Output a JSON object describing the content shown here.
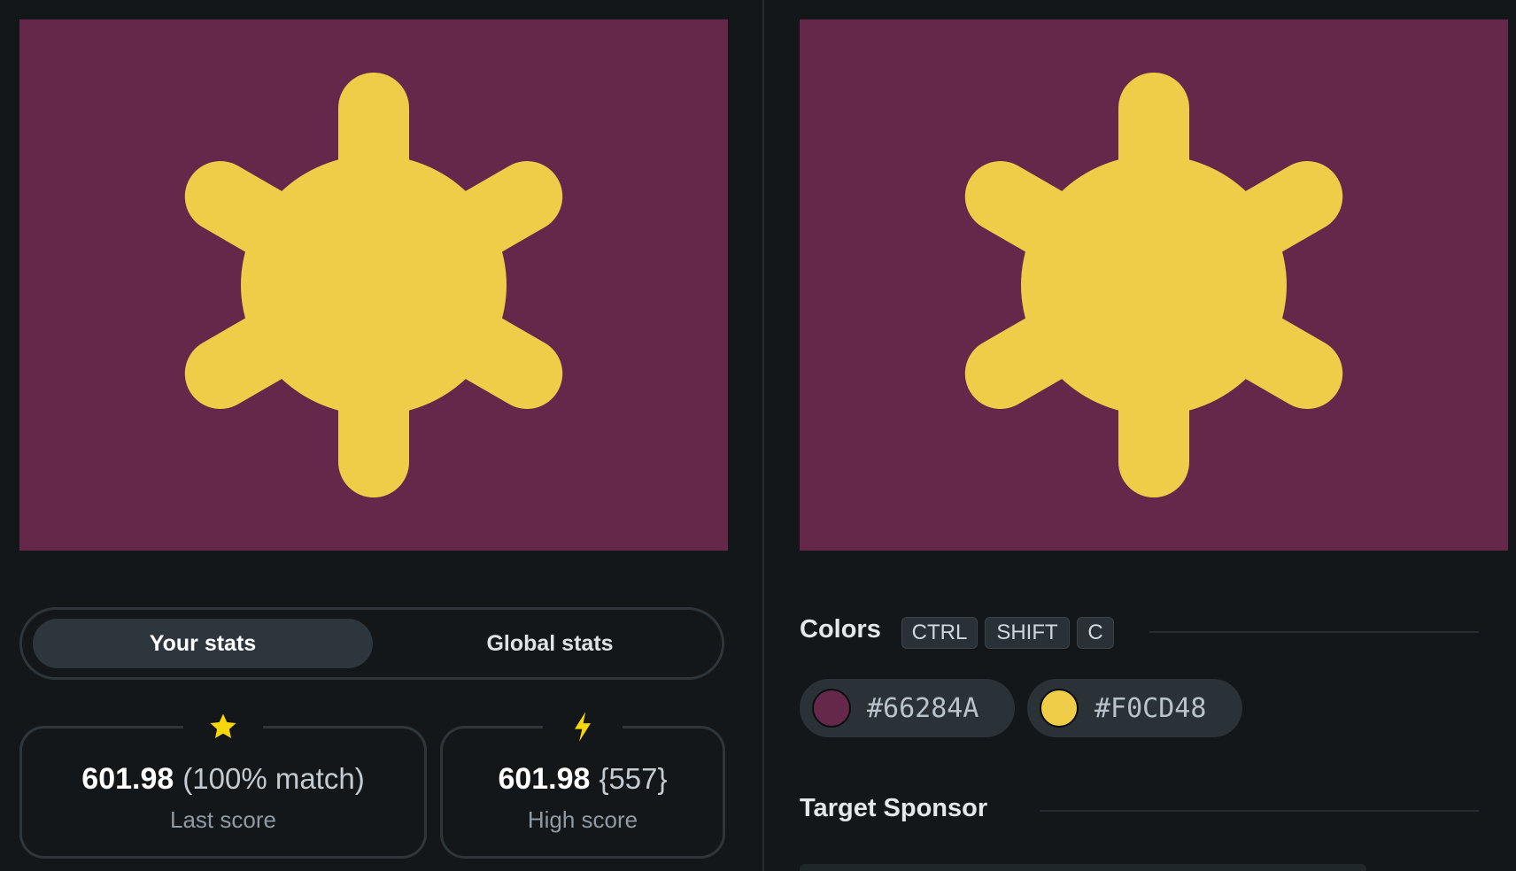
{
  "canvases": {
    "left": {
      "name": "your drawing"
    },
    "right": {
      "name": "target image"
    },
    "background_color": "#66284A",
    "shape_color": "#F0CD48",
    "shape_icon": "sun-gear-icon"
  },
  "stats_toggle": {
    "your_stats_label": "Your stats",
    "global_stats_label": "Global stats",
    "active": "Your stats"
  },
  "last_score": {
    "icon": "star-icon",
    "value": "601.98",
    "extra": "(100% match)",
    "label": "Last score"
  },
  "high_score": {
    "icon": "lightning-icon",
    "value": "601.98",
    "extra": "{557}",
    "label": "High score"
  },
  "colors": {
    "title": "Colors",
    "shortcut_keys": [
      "CTRL",
      "SHIFT",
      "C"
    ],
    "swatches": [
      {
        "hex": "#66284A",
        "color": "#66284A"
      },
      {
        "hex": "#F0CD48",
        "color": "#F0CD48"
      }
    ]
  },
  "sponsor": {
    "title": "Target Sponsor"
  },
  "theme": {
    "accent_yellow": "#F7D60A",
    "page_bg": "#131719"
  }
}
